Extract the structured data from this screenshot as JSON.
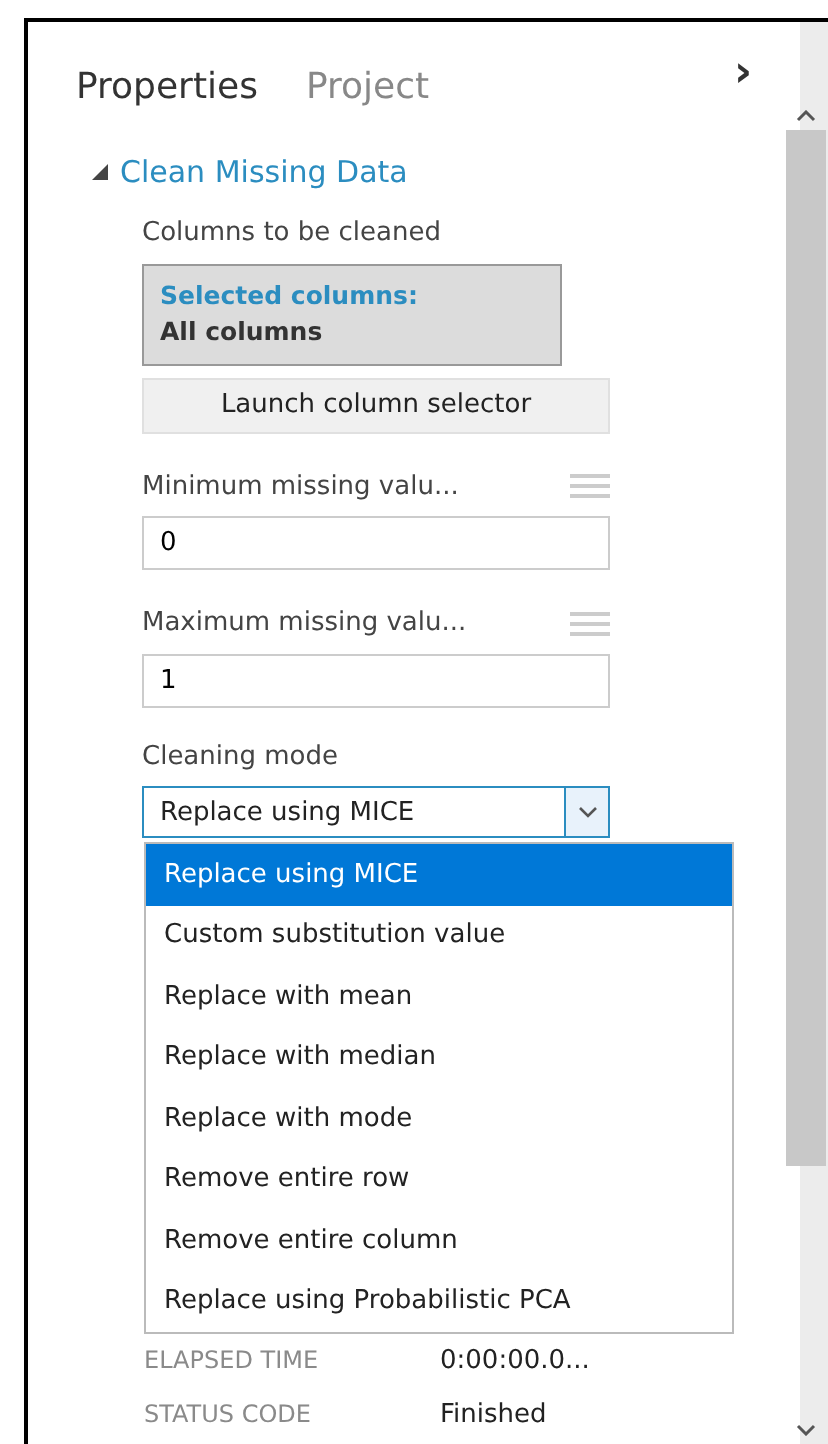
{
  "tabs": [
    {
      "label": "Properties",
      "selected": true
    },
    {
      "label": "Project",
      "selected": false
    }
  ],
  "collapse_glyph": "›",
  "section": {
    "title": "Clean Missing Data",
    "expanded": true
  },
  "columns": {
    "label": "Columns to be cleaned",
    "selected_label": "Selected columns:",
    "selected_value": "All columns",
    "button": "Launch column selector"
  },
  "fields": [
    {
      "label": "Minimum missing valu...",
      "value": "0"
    },
    {
      "label": "Maximum missing valu...",
      "value": "1"
    }
  ],
  "cleaning_mode": {
    "label": "Cleaning mode",
    "value": "Replace using MICE",
    "expanded": true,
    "options": [
      {
        "label": "Replace using MICE",
        "selected": true
      },
      {
        "label": "Custom substitution value",
        "selected": false
      },
      {
        "label": "Replace with mean",
        "selected": false
      },
      {
        "label": "Replace with median",
        "selected": false
      },
      {
        "label": "Replace with mode",
        "selected": false
      },
      {
        "label": "Remove entire row",
        "selected": false
      },
      {
        "label": "Remove entire column",
        "selected": false
      },
      {
        "label": "Replace using Probabilistic PCA",
        "selected": false
      }
    ]
  },
  "details": [
    {
      "name": "ELAPSED TIME",
      "value": "0:00:00.0..."
    },
    {
      "name": "STATUS CODE",
      "value": "Finished"
    }
  ]
}
